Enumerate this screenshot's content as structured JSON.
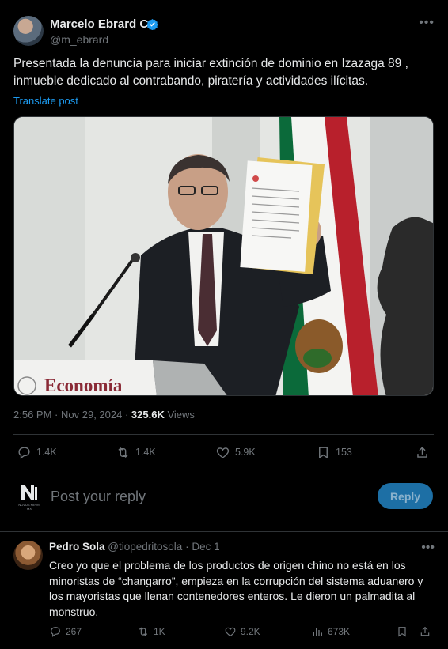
{
  "post": {
    "author_name": "Marcelo Ebrard C.",
    "author_handle": "@m_ebrard",
    "text": "Presentada la denuncia para iniciar extinción de dominio en Izazaga  89 , inmueble dedicado al contrabando, piratería y actividades ilícitas.",
    "translate_label": "Translate post",
    "photo": {
      "podium_label": "Economía",
      "icons": [
        "microphone-icon",
        "mexican-flag",
        "document"
      ]
    },
    "time": "2:56 PM",
    "date": "Nov 29, 2024",
    "views_count": "325.6K",
    "views_label": "Views",
    "stats": {
      "replies": "1.4K",
      "reposts": "1.4K",
      "likes": "5.9K",
      "bookmarks": "153"
    }
  },
  "composer": {
    "placeholder": "Post your reply",
    "reply_button": "Reply",
    "logo_text": "NOVUS NEWS MX"
  },
  "reply": {
    "author_name": "Pedro Sola",
    "author_handle": "@tiopedritosola",
    "date": "Dec 1",
    "text": "Creo yo que el problema de los productos de origen chino no está en los minoristas de “changarro”, empieza en la corrupción del sistema aduanero y los mayoristas que llenan contenedores enteros. Le dieron un palmadita al monstruo.",
    "stats": {
      "replies": "267",
      "reposts": "1K",
      "likes": "9.2K",
      "views": "673K"
    }
  },
  "colors": {
    "background": "#000000",
    "text": "#e7e9ea",
    "muted": "#71767b",
    "accent": "#1d9bf0",
    "divider": "#2f3336"
  }
}
